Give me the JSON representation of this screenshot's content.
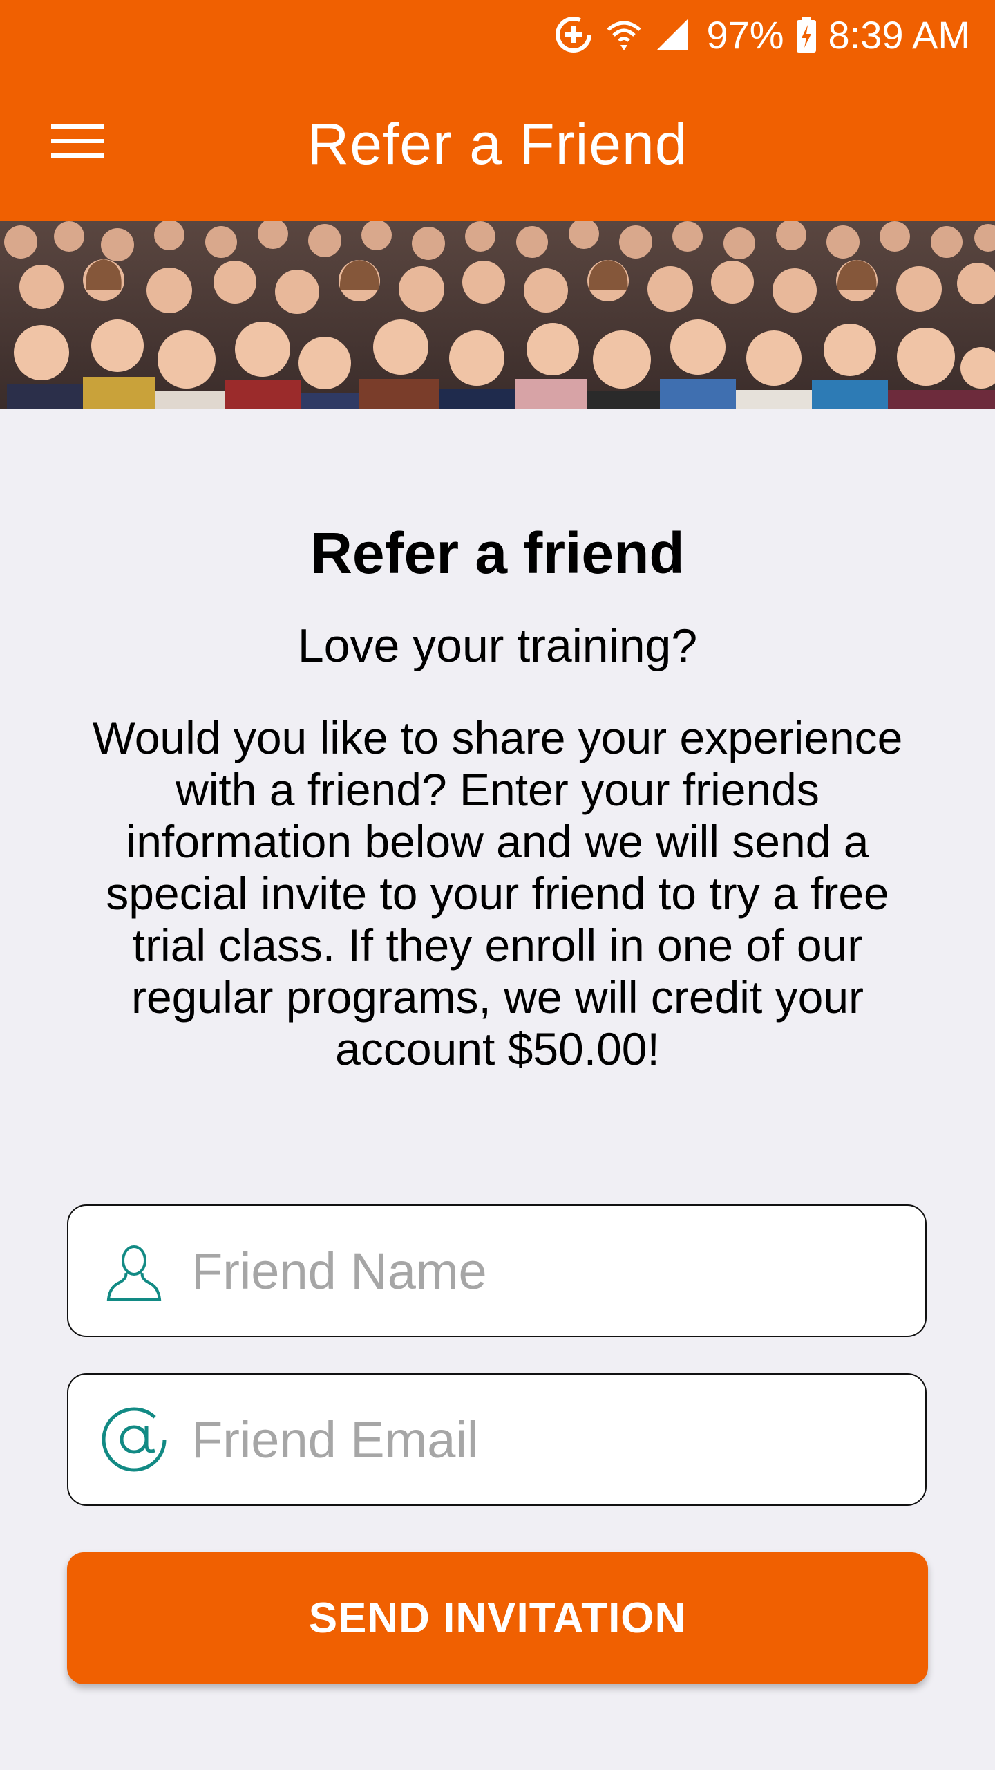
{
  "status_bar": {
    "battery": "97%",
    "time": "8:39 AM"
  },
  "app_bar": {
    "title": "Refer a Friend"
  },
  "content": {
    "heading": "Refer a friend",
    "subheading": "Love your training?",
    "body": "Would you like to share your experience with a friend? Enter your friends information below and we will send a special invite to your friend to try a free trial class. If they enroll in one of our regular programs, we will credit your account $50.00!"
  },
  "form": {
    "name_placeholder": "Friend Name",
    "email_placeholder": "Friend Email",
    "submit_label": "SEND INVITATION"
  },
  "colors": {
    "brand": "#f06001",
    "icon_teal": "#128a84",
    "background": "#f0eff4"
  }
}
